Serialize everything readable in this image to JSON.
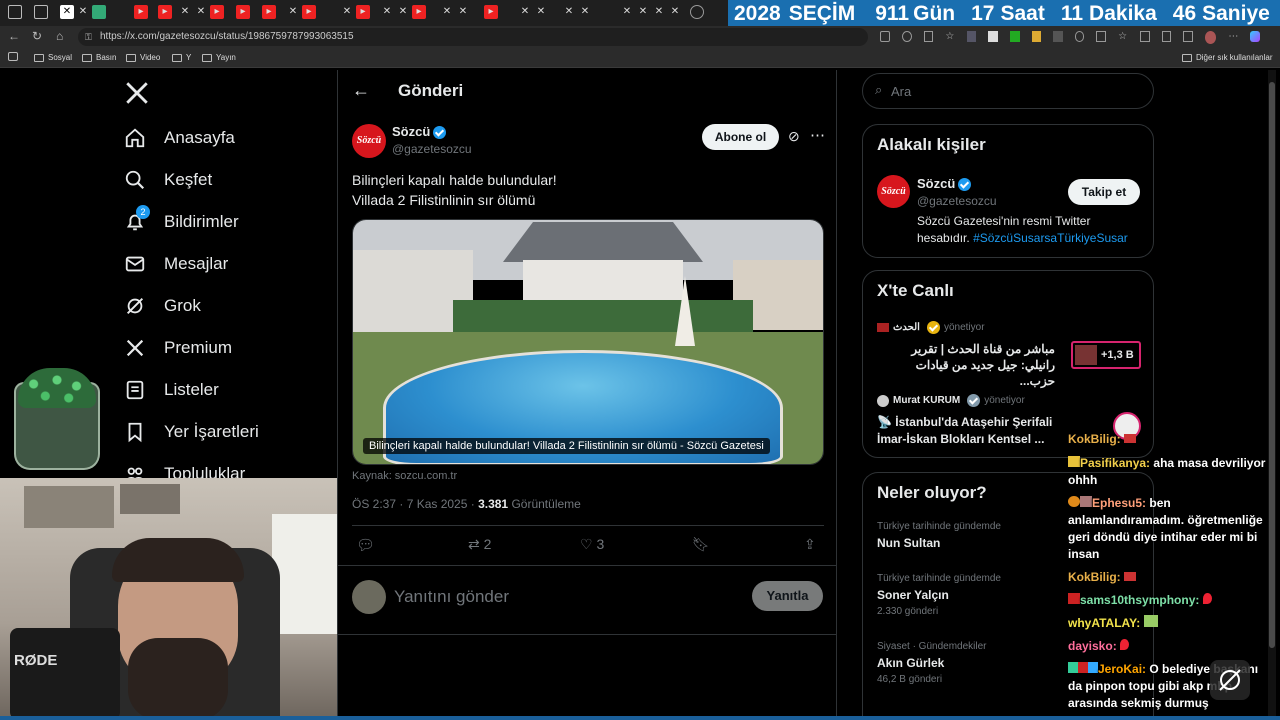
{
  "browser": {
    "url": "https://x.com/gazetesozcu/status/1986759787993063515",
    "bookmarks": [
      "Sosyal",
      "Basın",
      "Video",
      "Y",
      "Yayın"
    ],
    "other_bookmarks": "Diğer sık kullanılanlar"
  },
  "countdown": {
    "year": "2028",
    "label": "SEÇİM",
    "days": "911",
    "days_label": "Gün",
    "hours": "17",
    "hours_label": "Saat",
    "minutes": "11",
    "minutes_label": "Dakika",
    "seconds": "46",
    "seconds_label": "Saniye"
  },
  "sidebar": {
    "items": [
      {
        "label": "Anasayfa",
        "icon": "home-icon"
      },
      {
        "label": "Keşfet",
        "icon": "search-icon"
      },
      {
        "label": "Bildirimler",
        "icon": "bell-icon",
        "badge": "2"
      },
      {
        "label": "Mesajlar",
        "icon": "mail-icon"
      },
      {
        "label": "Grok",
        "icon": "grok-icon"
      },
      {
        "label": "Premium",
        "icon": "x-icon"
      },
      {
        "label": "Listeler",
        "icon": "list-icon"
      },
      {
        "label": "Yer İşaretleri",
        "icon": "bookmark-icon"
      },
      {
        "label": "Topluluklar",
        "icon": "community-icon"
      }
    ]
  },
  "header": {
    "title": "Gönderi"
  },
  "post": {
    "author_name": "Sözcü",
    "author_handle": "@gazetesozcu",
    "subscribe_label": "Abone ol",
    "text_line1": "Bilinçleri kapalı halde bulundular!",
    "text_line2": "Villada 2 Filistinlinin sır ölümü",
    "image_caption": "Bilinçleri kapalı halde bulundular! Villada 2 Filistinlinin sır ölümü - Sözcü Gazetesi",
    "source": "Kaynak: sozcu.com.tr",
    "time": "ÖS 2:37 · 7 Kas 2025 · ",
    "views": "3.381",
    "views_label": "Görüntüleme",
    "reposts": "2",
    "likes": "3",
    "reply_placeholder": "Yanıtını gönder",
    "reply_button": "Yanıtla"
  },
  "right": {
    "search_placeholder": "Ara",
    "relevant": {
      "title": "Alakalı kişiler",
      "name": "Sözcü",
      "handle": "@gazetesozcu",
      "follow_label": "Takip et",
      "bio": "Sözcü Gazetesi'nin resmi Twitter hesabıdır.",
      "hashtag": "#SözcüSusarsaTürkiyeSusar"
    },
    "live": {
      "title": "X'te Canlı",
      "items": [
        {
          "host": "الحدث",
          "status": "yönetiyor",
          "line1": "مباشر من قناة الحدث | تقرير",
          "line2": "رانيلي: جيل جديد من قيادات حزب...",
          "listeners": "+1,3 B"
        },
        {
          "host": "Murat KURUM",
          "status": "yönetiyor",
          "line1": "📡 İstanbul'da Ataşehir Şerifali",
          "line2": "İmar-İskan Blokları Kentsel ..."
        }
      ]
    },
    "trends": {
      "title": "Neler oluyor?",
      "items": [
        {
          "context": "Türkiye tarihinde gündemde",
          "name": "Nun Sultan",
          "count": ""
        },
        {
          "context": "Türkiye tarihinde gündemde",
          "name": "Soner Yalçın",
          "count": "2.330 gönderi"
        },
        {
          "context": "Siyaset · Gündemdekiler",
          "name": "Akın Gürlek",
          "count": "46,2 B gönderi"
        }
      ]
    }
  },
  "chat": [
    {
      "user": "KokBilig:",
      "msg": "",
      "color": "#e8b04a"
    },
    {
      "user": "Pasifikanya:",
      "msg": "aha masa devriliyor ohhh",
      "color": "#f2d04b"
    },
    {
      "user": "Ephesu5:",
      "msg": "ben anlamlandıramadım. öğretmenliğe geri döndü diye intihar eder mi bi insan",
      "color": "#ffa07a"
    },
    {
      "user": "KokBilig:",
      "msg": "",
      "color": "#e8b04a"
    },
    {
      "user": "sams10thsymphony:",
      "msg": "",
      "color": "#7ee0a8"
    },
    {
      "user": "whyATALAY:",
      "msg": "",
      "color": "#f2e34b"
    },
    {
      "user": "dayisko:",
      "msg": "",
      "color": "#ff6f9c"
    },
    {
      "user": "JeroKai:",
      "msg": "O belediye başkanı da pinpon topu gibi akp mhp arasında sekmiş durmuş",
      "color": "#ffa500"
    }
  ]
}
